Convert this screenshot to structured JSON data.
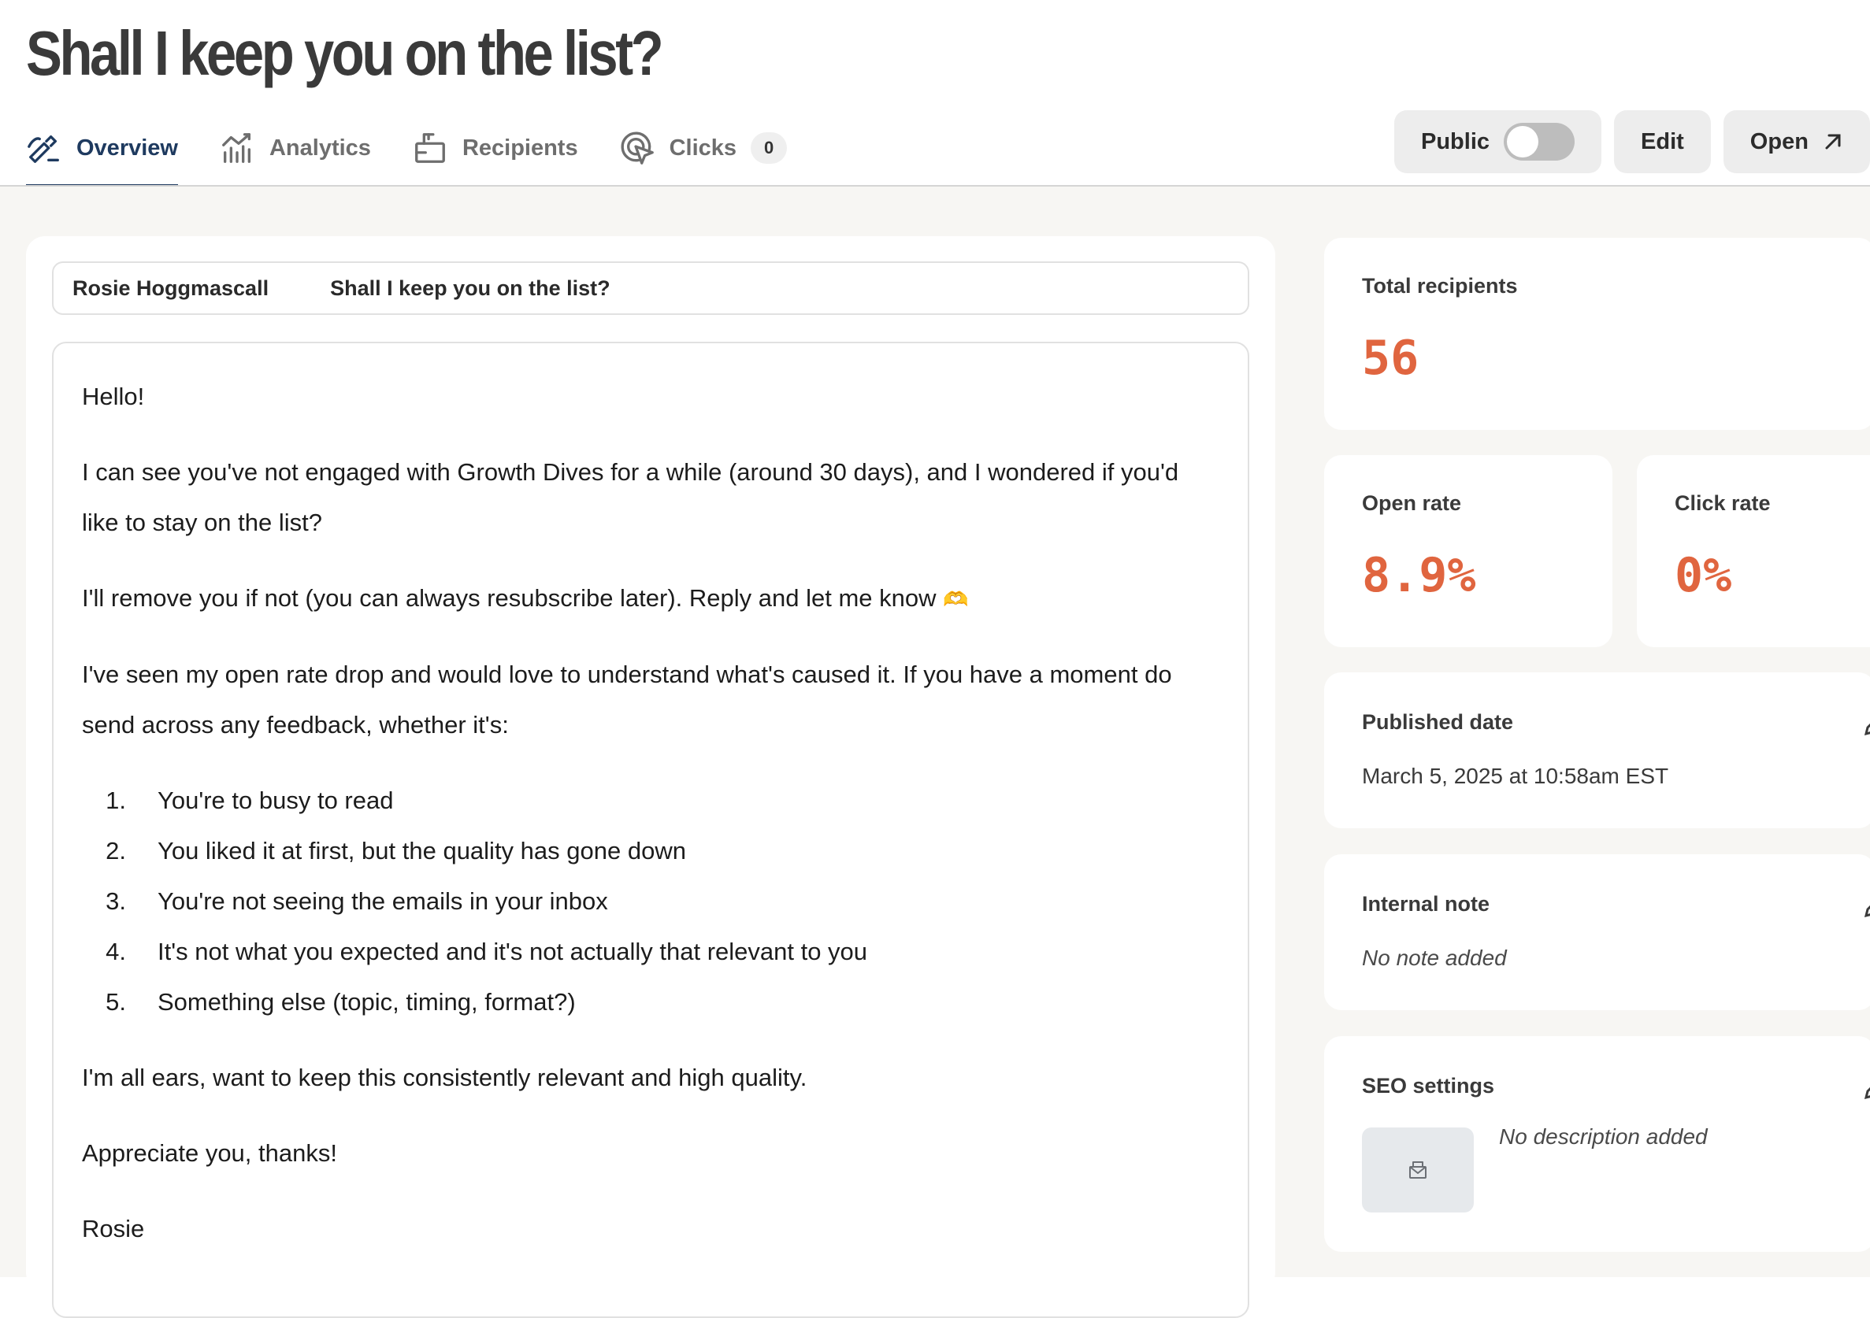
{
  "page": {
    "title": "Shall I keep you on the list?"
  },
  "tabs": [
    {
      "label": "Overview",
      "icon": "pencil-icon",
      "active": true
    },
    {
      "label": "Analytics",
      "icon": "bar-chart-icon"
    },
    {
      "label": "Recipients",
      "icon": "inbox-icon"
    },
    {
      "label": "Clicks",
      "icon": "cursor-click-icon",
      "count": "0"
    }
  ],
  "header_buttons": {
    "public_label": "Public",
    "public_enabled": false,
    "edit_label": "Edit",
    "open_label": "Open"
  },
  "email": {
    "from": "Rosie Hoggmascall",
    "subject": "Shall I keep you on the list?",
    "greeting": "Hello!",
    "para1": "I can see you've not engaged with Growth Dives for a while (around 30 days), and I wondered if you'd like to stay on the list?",
    "para2": "I'll remove you if not (you can always resubscribe later). Reply and let me know",
    "para2_emoji": "🫶",
    "para3": "I've seen my open rate drop and would love to understand what's caused it. If you have a moment do send across any feedback, whether it's:",
    "list": [
      {
        "num": "1.",
        "text": "You're to busy to read"
      },
      {
        "num": "2.",
        "text": "You liked it at first, but the quality has gone down"
      },
      {
        "num": "3.",
        "text": "You're not seeing the emails in your inbox"
      },
      {
        "num": "4.",
        "text": "It's not what you expected and it's not actually that relevant to you"
      },
      {
        "num": "5.",
        "text": "Something else (topic, timing, format?)"
      }
    ],
    "para4": "I'm all ears, want to keep this consistently relevant and high quality.",
    "para5": "Appreciate you, thanks!",
    "signoff": "Rosie"
  },
  "stats": {
    "total_recipients_label": "Total recipients",
    "total_recipients": "56",
    "open_rate_label": "Open rate",
    "open_rate": "8.9%",
    "click_rate_label": "Click rate",
    "click_rate": "0%",
    "accent_color": "#e0653f"
  },
  "published": {
    "label": "Published date",
    "value": "March 5, 2025 at 10:58am EST"
  },
  "internal_note": {
    "label": "Internal note",
    "value": "No note added"
  },
  "seo": {
    "label": "SEO settings",
    "description": "No description added"
  }
}
